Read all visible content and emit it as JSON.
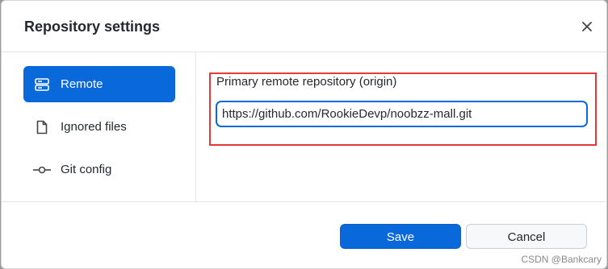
{
  "dialog": {
    "title": "Repository settings",
    "close_icon": "close-icon"
  },
  "sidebar": {
    "items": [
      {
        "label": "Remote",
        "icon": "server-icon",
        "active": true
      },
      {
        "label": "Ignored files",
        "icon": "file-icon",
        "active": false
      },
      {
        "label": "Git config",
        "icon": "git-commit-icon",
        "active": false
      }
    ]
  },
  "remote": {
    "label": "Primary remote repository (origin)",
    "url": "https://github.com/RookieDevp/noobzz-mall.git"
  },
  "footer": {
    "save_label": "Save",
    "cancel_label": "Cancel"
  },
  "watermark": "CSDN @Bankcary",
  "colors": {
    "accent": "#0969da",
    "highlight_border": "#e53935"
  }
}
